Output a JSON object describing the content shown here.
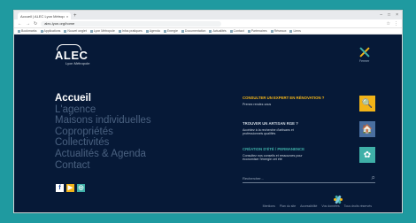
{
  "browser": {
    "tab_title": "Accueil | ALEC Lyon Métropole",
    "tab_close": "×",
    "new_tab": "+",
    "url": "alec-lyon.org/home",
    "nav_back": "←",
    "nav_forward": "→",
    "reload": "↻",
    "star": "☆",
    "menu": "⋮",
    "window_controls": [
      "–",
      "□",
      "×"
    ],
    "bookmarks": [
      "Bookmarks",
      "Applications",
      "Nouvel onglet",
      "Lyon Métropole",
      "Infos pratiques",
      "Agenda",
      "Energie",
      "Documentation",
      "Actualités",
      "Contact",
      "Partenaires",
      "Réseaux",
      "Liens"
    ]
  },
  "site": {
    "logo": {
      "word": "ALEC",
      "sub": "Lyon Métropole"
    },
    "close_label": "Fermer",
    "menu": [
      "Accueil",
      "L'agence",
      "Maisons individuelles",
      "Copropriétés",
      "Collectivités",
      "Actualités & Agenda",
      "Contact"
    ],
    "social": {
      "facebook": "f",
      "youtube": "▶",
      "instagram": "◎"
    },
    "panel": [
      {
        "title": "CONSULTER UN EXPERT EN RÉNOVATION ?",
        "desc": "Prenez rendez-vous",
        "icon": "🔍",
        "color": "#f2b418"
      },
      {
        "title": "TROUVER UN ARTISAN RGE ?",
        "desc": "Accédez à la recherche d'artisans et professionnels qualifiés",
        "icon": "🏠",
        "color": "#4a6fa0"
      },
      {
        "title": "CRÉATION D'ÉTÉ / PERMANENCE",
        "desc": "Consultez nos conseils et ressources pour économiser l'énergie cet été",
        "icon": "✿",
        "color": "#3fb0a8"
      }
    ],
    "panel_title_colors": [
      "#f2b418",
      "#cfd8e2",
      "#3fb0a8"
    ],
    "search_placeholder": "Rechercher...",
    "search_icon": "⌕",
    "footer": [
      "Mentions",
      "Plan du site",
      "Accessibilité",
      "Vos données",
      "Tous droits réservés"
    ]
  }
}
